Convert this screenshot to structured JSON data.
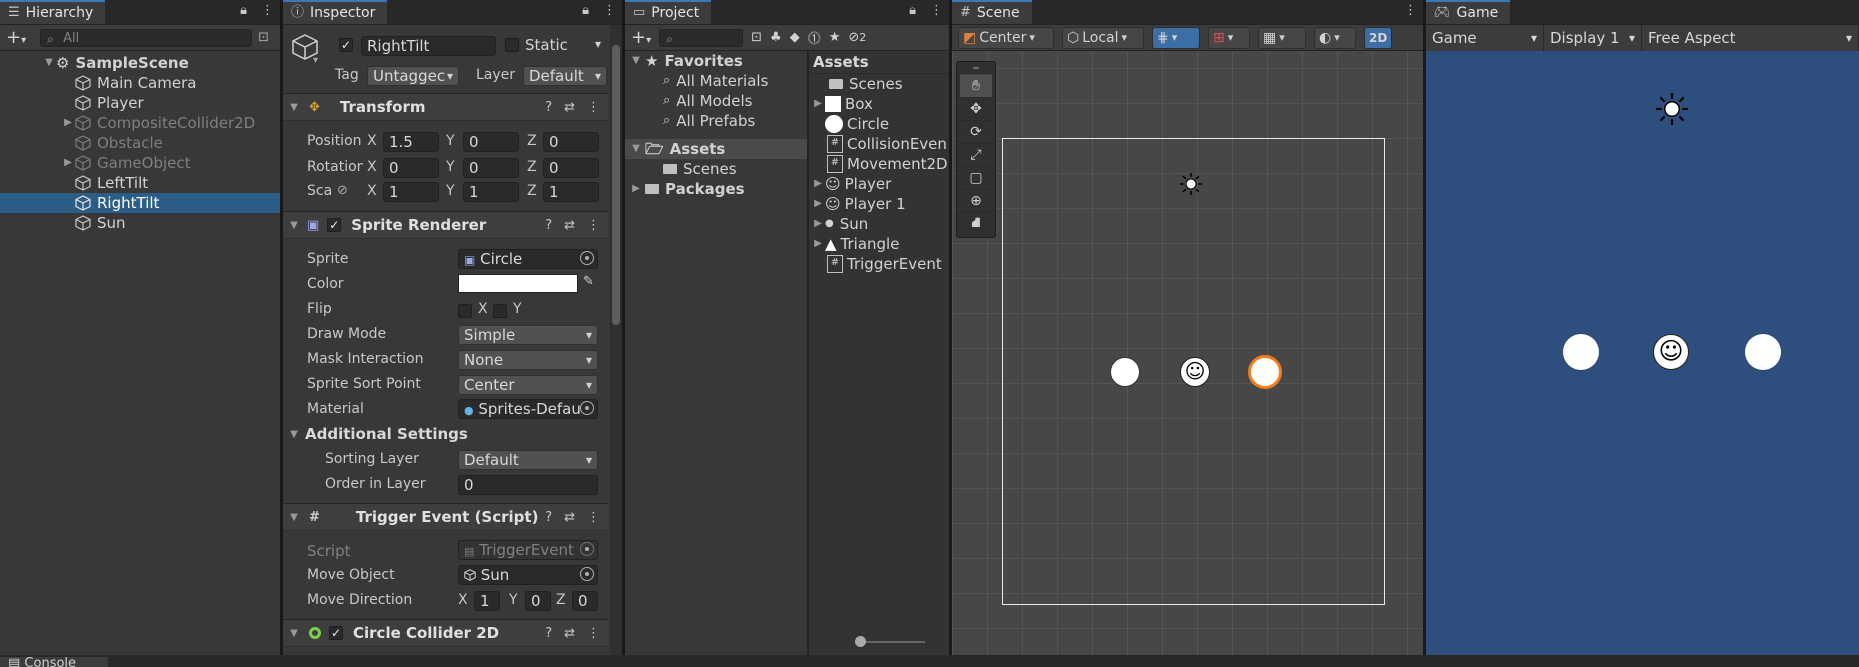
{
  "hierarchy": {
    "tab": "Hierarchy",
    "add_label": "+",
    "search_placeholder": "All",
    "scene": "SampleScene",
    "items": [
      {
        "label": "Main Camera"
      },
      {
        "label": "Player"
      },
      {
        "label": "CompositeCollider2D"
      },
      {
        "label": "Obstacle"
      },
      {
        "label": "GameObject"
      },
      {
        "label": "LeftTilt"
      },
      {
        "label": "RightTilt"
      },
      {
        "label": "Sun"
      }
    ]
  },
  "inspector": {
    "tab": "Inspector",
    "object_name": "RightTilt",
    "static_label": "Static",
    "tag_label": "Tag",
    "tag_value": "Untaggec",
    "layer_label": "Layer",
    "layer_value": "Default",
    "transform": {
      "title": "Transform",
      "position_label": "Position",
      "rotation_label": "Rotation",
      "scale_label": "Sca",
      "x": "X",
      "y": "Y",
      "z": "Z",
      "position": [
        "1.5",
        "0",
        "0"
      ],
      "rotation": [
        "0",
        "0",
        "0"
      ],
      "scale": [
        "1",
        "1",
        "1"
      ]
    },
    "sprite_renderer": {
      "title": "Sprite Renderer",
      "sprite_label": "Sprite",
      "sprite_value": "Circle",
      "color_label": "Color",
      "color_value": "#ffffff",
      "flip_label": "Flip",
      "flip_x": "X",
      "flip_y": "Y",
      "draw_mode_label": "Draw Mode",
      "draw_mode_value": "Simple",
      "mask_label": "Mask Interaction",
      "mask_value": "None",
      "sort_point_label": "Sprite Sort Point",
      "sort_point_value": "Center",
      "material_label": "Material",
      "material_value": "Sprites-Defau",
      "additional_label": "Additional Settings",
      "sorting_layer_label": "Sorting Layer",
      "sorting_layer_value": "Default",
      "order_label": "Order in Layer",
      "order_value": "0"
    },
    "trigger_event": {
      "title": "Trigger Event (Script)",
      "script_label": "Script",
      "script_value": "TriggerEvent",
      "move_object_label": "Move Object",
      "move_object_value": "Sun",
      "move_dir_label": "Move Direction",
      "x": "X",
      "y": "Y",
      "z": "Z",
      "move_dir": [
        "1",
        "0",
        "0"
      ]
    },
    "circle_collider": {
      "title": "Circle Collider 2D"
    }
  },
  "project": {
    "tab": "Project",
    "add_label": "+",
    "favorites_label": "Favorites",
    "favorites": [
      "All Materials",
      "All Models",
      "All Prefabs"
    ],
    "assets_label": "Assets",
    "assets_children": [
      "Scenes"
    ],
    "packages_label": "Packages",
    "assets_header": "Assets",
    "assets_list": [
      {
        "label": "Scenes"
      },
      {
        "label": "Box"
      },
      {
        "label": "Circle"
      },
      {
        "label": "CollisionEven"
      },
      {
        "label": "Movement2D"
      },
      {
        "label": "Player"
      },
      {
        "label": "Player 1"
      },
      {
        "label": "Sun"
      },
      {
        "label": "Triangle"
      },
      {
        "label": "TriggerEvent"
      }
    ],
    "hidden_count": "2"
  },
  "scene": {
    "tab": "Scene",
    "pivot_label": "Center",
    "space_label": "Local",
    "mode_2d": "2D"
  },
  "game": {
    "tab": "Game",
    "view_label": "Game",
    "display_label": "Display 1",
    "aspect_label": "Free Aspect",
    "background": "#2e4f7e"
  },
  "console": {
    "tab": "Console"
  }
}
